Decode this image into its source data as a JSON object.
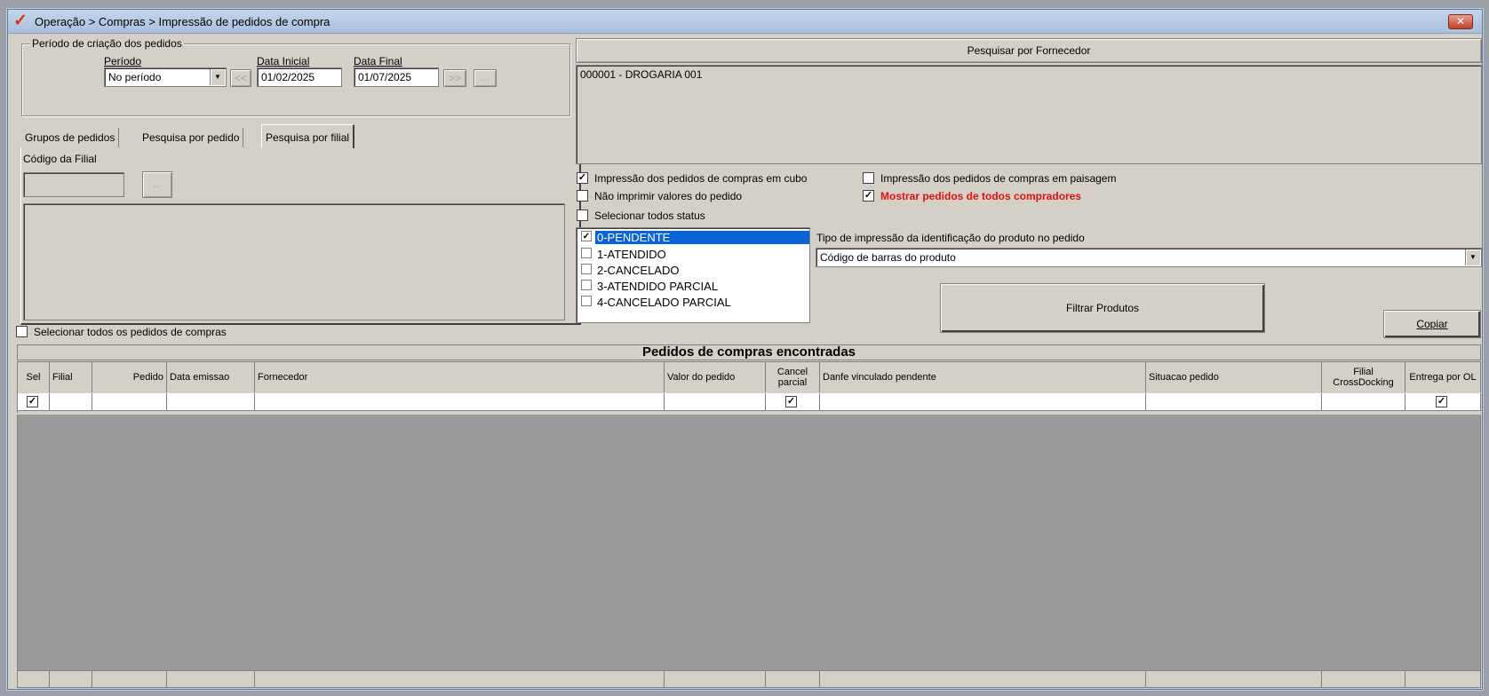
{
  "window": {
    "title": "Operação > Compras > Impressão de pedidos de compra",
    "close_glyph": "✕"
  },
  "periodo_group": {
    "legend": "Período de criação dos pedidos",
    "periodo_label": "Período",
    "periodo_value": "No período",
    "data_inicial_label": "Data Inicial",
    "data_inicial_value": "01/02/2025",
    "data_final_label": "Data Final",
    "data_final_value": "01/07/2025",
    "prev_btn": "<<",
    "next_btn": ">>",
    "more_btn": "..."
  },
  "tabs": [
    {
      "label": "Grupos de pedidos"
    },
    {
      "label": "Pesquisa por pedido"
    },
    {
      "label": "Pesquisa por filial"
    }
  ],
  "filial": {
    "codigo_label": "Código da Filial",
    "codigo_value": "",
    "lookup_btn": "..."
  },
  "select_all_pedidos": {
    "label": "Selecionar todos os pedidos de compras",
    "checked": false
  },
  "fornecedor": {
    "header": "Pesquisar por Fornecedor",
    "items": [
      "000001 - DROGARIA 001"
    ]
  },
  "options": {
    "cubo": {
      "label": "Impressão dos pedidos de compras em cubo",
      "checked": true
    },
    "paisagem": {
      "label": "Impressão dos pedidos de compras em paisagem",
      "checked": false
    },
    "nao_imprimir": {
      "label": "Não imprimir valores do pedido",
      "checked": false
    },
    "mostrar_todos": {
      "label": "Mostrar pedidos de todos compradores",
      "checked": true,
      "color": "#e01010"
    },
    "selecionar_status": {
      "label": "Selecionar todos status",
      "checked": false
    }
  },
  "status_list": [
    {
      "label": "0-PENDENTE",
      "checked": true,
      "selected": true
    },
    {
      "label": "1-ATENDIDO",
      "checked": false,
      "selected": false
    },
    {
      "label": "2-CANCELADO",
      "checked": false,
      "selected": false
    },
    {
      "label": "3-ATENDIDO PARCIAL",
      "checked": false,
      "selected": false
    },
    {
      "label": "4-CANCELADO PARCIAL",
      "checked": false,
      "selected": false
    }
  ],
  "tipo_impressao": {
    "label": "Tipo de impressão da identificação do produto no pedido",
    "value": "Código de barras do produto"
  },
  "buttons": {
    "filtrar": "Filtrar Produtos",
    "copiar": "Copiar"
  },
  "grid": {
    "title": "Pedidos de compras encontradas",
    "columns": [
      "Sel",
      "Filial",
      "Pedido",
      "Data emissao",
      "Fornecedor",
      "Valor do pedido",
      "Cancel parcial",
      "Danfe vinculado pendente",
      "Situacao pedido",
      "Filial CrossDocking",
      "Entrega por OL"
    ],
    "row_checks": {
      "sel": true,
      "cancel_parcial": true,
      "entrega_ol": true
    },
    "check_glyph": "✓",
    "empty_area_color": "#9a9a9a"
  }
}
